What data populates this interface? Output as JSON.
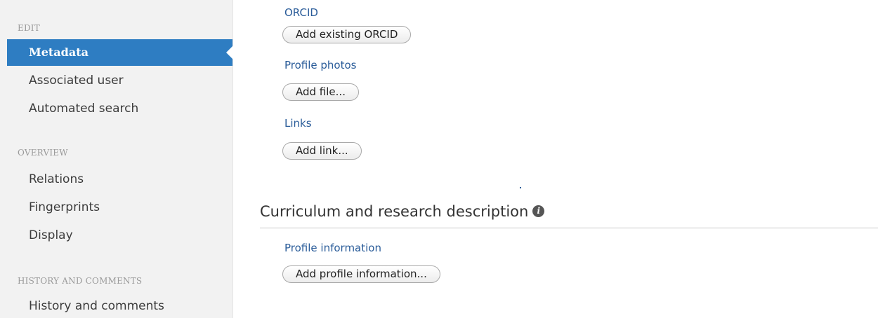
{
  "sidebar": {
    "sections": [
      {
        "label": "EDIT",
        "items": [
          "Metadata",
          "Associated user",
          "Automated search"
        ]
      },
      {
        "label": "OVERVIEW",
        "items": [
          "Relations",
          "Fingerprints",
          "Display"
        ]
      },
      {
        "label": "HISTORY AND COMMENTS",
        "items": [
          "History and comments"
        ]
      }
    ],
    "active_item": "Metadata"
  },
  "main": {
    "orcid": {
      "label": "ORCID",
      "button": "Add existing ORCID"
    },
    "profile_photos": {
      "label": "Profile photos",
      "button": "Add file..."
    },
    "links": {
      "label": "Links",
      "button": "Add link..."
    },
    "curriculum": {
      "title": "Curriculum and research description",
      "info_icon": "info-icon",
      "profile_information": {
        "label": "Profile information",
        "button": "Add profile information..."
      }
    }
  },
  "colors": {
    "sidebar_bg": "#f2f2f2",
    "active_bg": "#2e7dc2",
    "label_blue": "#2a5c99"
  }
}
